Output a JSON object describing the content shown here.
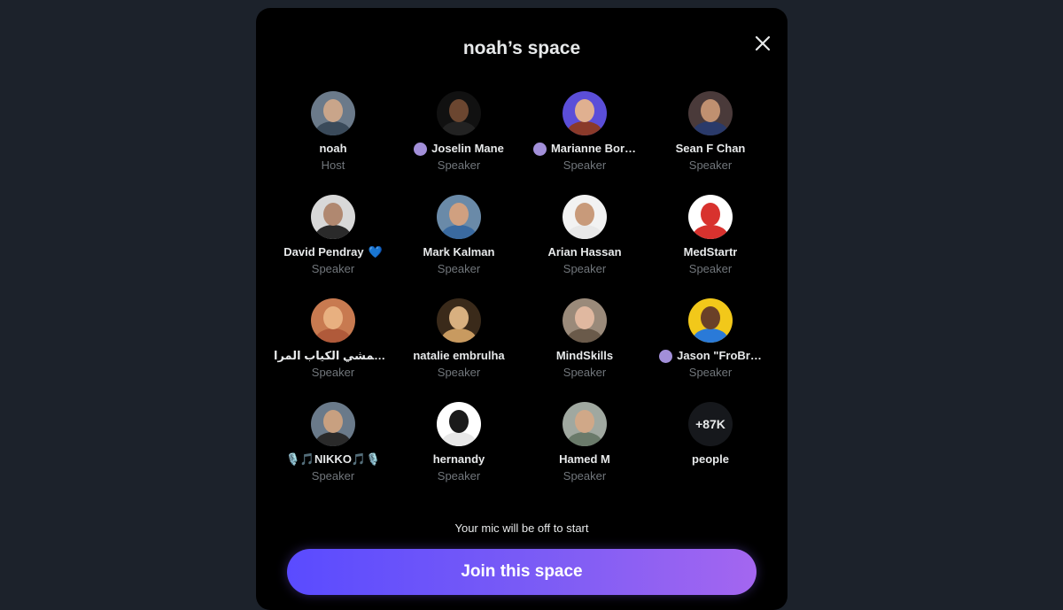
{
  "modal": {
    "title": "noah’s space",
    "mic_note": "Your mic will be off to start",
    "join_label": "Join this space"
  },
  "participants": [
    {
      "name": "noah",
      "role": "Host",
      "badge": false,
      "suffix": "",
      "bg": "#6b7a8a",
      "face": "#c9a58a",
      "body": "#3a4a5a"
    },
    {
      "name": "Joselin Mane",
      "role": "Speaker",
      "badge": true,
      "suffix": "",
      "bg": "#111111",
      "face": "#6b4630",
      "body": "#222222"
    },
    {
      "name": "Marianne Bor…",
      "role": "Speaker",
      "badge": true,
      "suffix": "",
      "bg": "#5b4ed8",
      "face": "#e0b090",
      "body": "#8a3a2a"
    },
    {
      "name": "Sean F Chan",
      "role": "Speaker",
      "badge": false,
      "suffix": "",
      "bg": "#4a3a3a",
      "face": "#c09070",
      "body": "#2a3a6a"
    },
    {
      "name": "David Pendray",
      "role": "Speaker",
      "badge": false,
      "suffix": "💙",
      "bg": "#d8d8d8",
      "face": "#b08870",
      "body": "#2a2a2a"
    },
    {
      "name": "Mark Kalman",
      "role": "Speaker",
      "badge": false,
      "suffix": "",
      "bg": "#6a8aa8",
      "face": "#d0a080",
      "body": "#3a6aa0"
    },
    {
      "name": "Arian Hassan",
      "role": "Speaker",
      "badge": false,
      "suffix": "",
      "bg": "#f2f2f2",
      "face": "#c89a7a",
      "body": "#e8e8e8"
    },
    {
      "name": "MedStartr",
      "role": "Speaker",
      "badge": false,
      "suffix": "",
      "bg": "#ffffff",
      "face": "#d8322e",
      "body": "#d8322e"
    },
    {
      "name": "ضياشمشي الكياب المرا 🌙",
      "role": "Speaker",
      "badge": false,
      "suffix": "",
      "bg": "#c87a50",
      "face": "#e8b080",
      "body": "#b05a3a"
    },
    {
      "name": "natalie embrulha",
      "role": "Speaker",
      "badge": false,
      "suffix": "",
      "bg": "#3a2a1a",
      "face": "#d8b080",
      "body": "#c89a60"
    },
    {
      "name": "MindSkills",
      "role": "Speaker",
      "badge": false,
      "suffix": "",
      "bg": "#9a8a7a",
      "face": "#e0b8a0",
      "body": "#6a5a4a"
    },
    {
      "name": "Jason \"FroBr…",
      "role": "Speaker",
      "badge": true,
      "suffix": "",
      "bg": "#f2c81a",
      "face": "#6a4028",
      "body": "#2a7ad8"
    },
    {
      "name": "🎙️🎵NIKKO🎵🎙️",
      "role": "Speaker",
      "badge": false,
      "suffix": "",
      "bg": "#6a7a8a",
      "face": "#c8a080",
      "body": "#2a2a2a"
    },
    {
      "name": "hernandy",
      "role": "Speaker",
      "badge": false,
      "suffix": "",
      "bg": "#ffffff",
      "face": "#1a1a1a",
      "body": "#e8e8e8"
    },
    {
      "name": "Hamed M",
      "role": "Speaker",
      "badge": false,
      "suffix": "",
      "bg": "#a0a8a0",
      "face": "#d0a888",
      "body": "#6a7a6a"
    }
  ],
  "overflow": {
    "count": "+87K",
    "label": "people"
  },
  "colors": {
    "background": "#1c222b",
    "modal": "#000000",
    "badge": "#a28fd9",
    "role_text": "#71767b",
    "button_gradient_start": "#5a4bff",
    "button_gradient_end": "#a466f0"
  }
}
